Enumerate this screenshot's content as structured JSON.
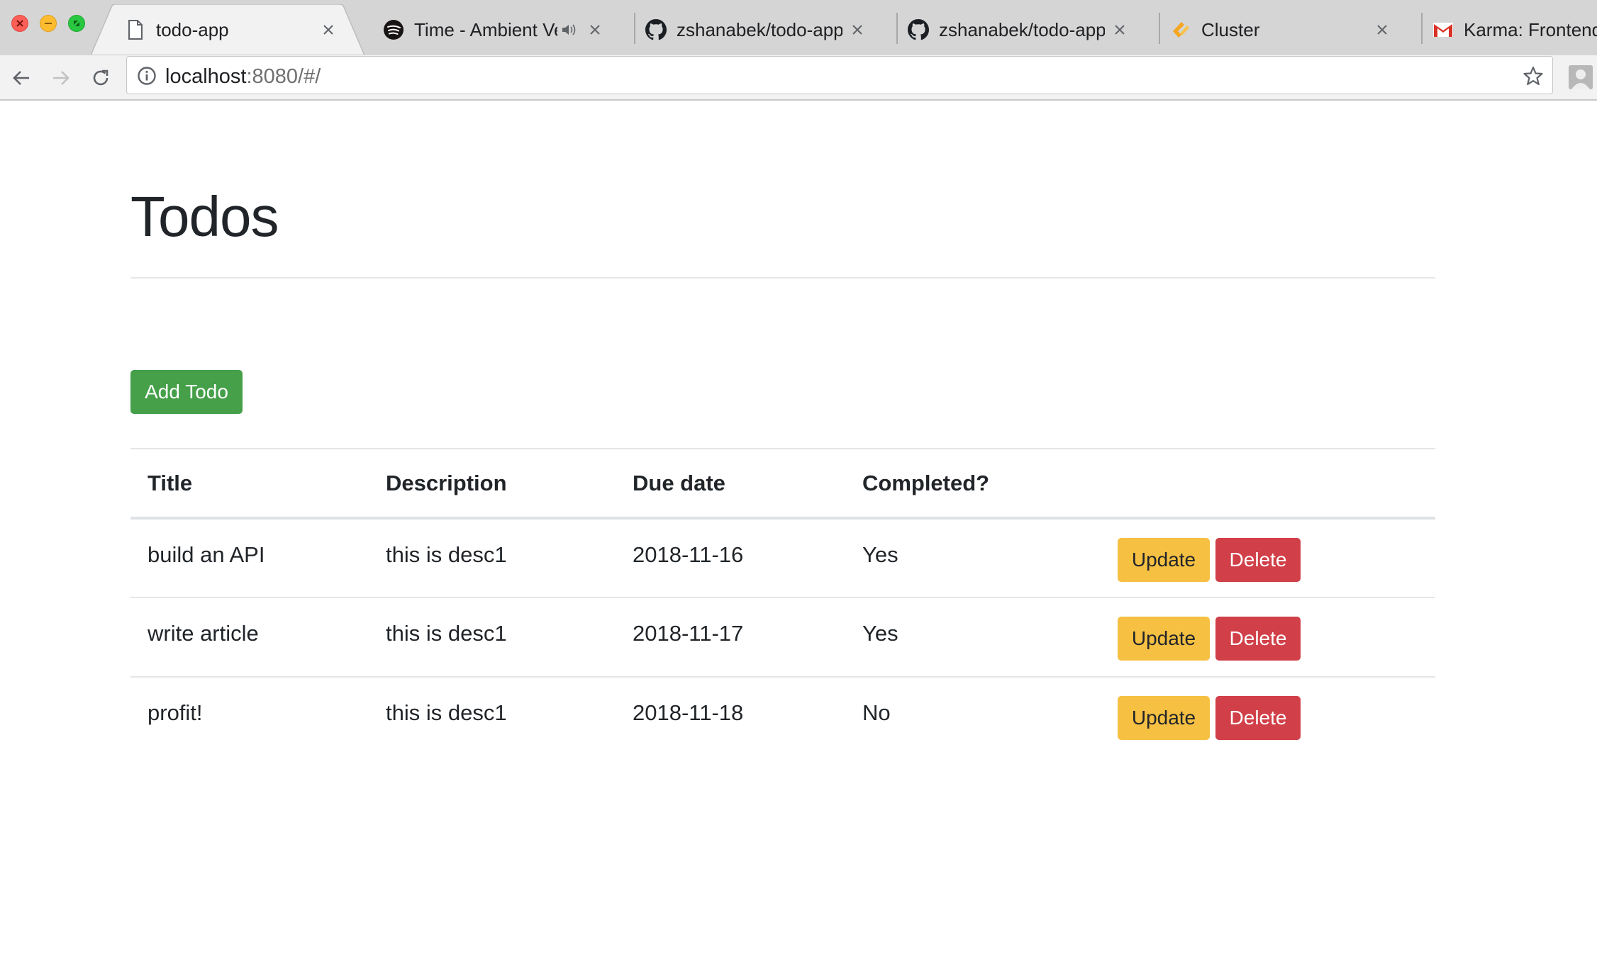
{
  "browser": {
    "tabs": [
      {
        "label": "todo-app",
        "icon": "document-icon",
        "active": true
      },
      {
        "label": "Time - Ambient Vers",
        "icon": "spotify-icon",
        "audio": true
      },
      {
        "label": "zshanabek/todo-app: S",
        "icon": "github-icon"
      },
      {
        "label": "zshanabek/todo-app: S",
        "icon": "github-icon"
      },
      {
        "label": "Cluster",
        "icon": "cluster-icon"
      },
      {
        "label": "Karma: Frontend",
        "icon": "gmail-icon"
      }
    ],
    "address": {
      "host": "localhost",
      "rest": ":8080/#/"
    }
  },
  "page": {
    "title": "Todos",
    "add_label": "Add Todo"
  },
  "table": {
    "headers": {
      "title": "Title",
      "description": "Description",
      "due": "Due date",
      "completed": "Completed?"
    },
    "rows": [
      {
        "title": "build an API",
        "description": "this is desc1",
        "due": "2018-11-16",
        "completed": "Yes",
        "update": "Update",
        "delete": "Delete"
      },
      {
        "title": "write article",
        "description": "this is desc1",
        "due": "2018-11-17",
        "completed": "Yes",
        "update": "Update",
        "delete": "Delete"
      },
      {
        "title": "profit!",
        "description": "this is desc1",
        "due": "2018-11-18",
        "completed": "No",
        "update": "Update",
        "delete": "Delete"
      }
    ]
  },
  "colors": {
    "add": "#45a049",
    "update": "#f6c043",
    "delete": "#d13f48"
  }
}
